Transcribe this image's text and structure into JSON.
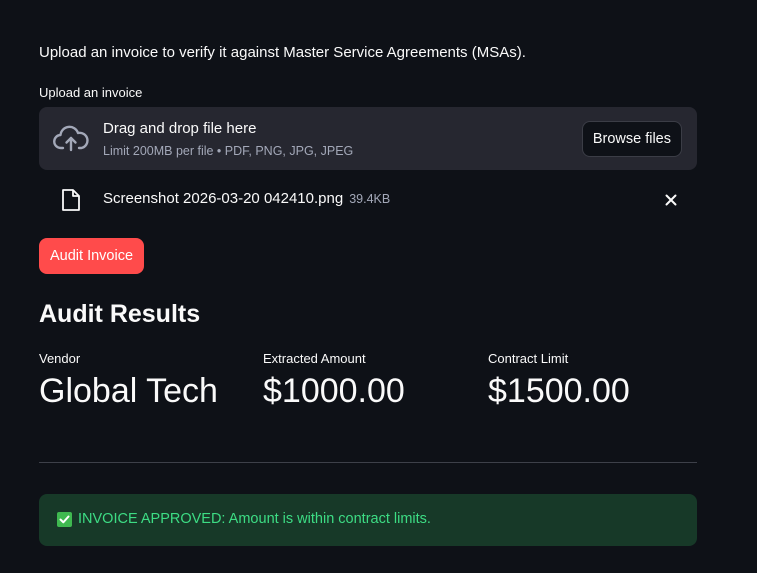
{
  "intro_text": "Upload an invoice to verify it against Master Service Agreements (MSAs).",
  "uploader": {
    "label": "Upload an invoice",
    "drop_title": "Drag and drop file here",
    "limit_text": "Limit 200MB per file • PDF, PNG, JPG, JPEG",
    "browse_label": "Browse files",
    "icon": "cloud-upload-icon"
  },
  "uploaded_file": {
    "name": "Screenshot 2026-03-20 042410.png",
    "size": "39.4KB",
    "icon": "file-icon",
    "remove_icon": "close-icon"
  },
  "audit_button_label": "Audit Invoice",
  "results": {
    "title": "Audit Results",
    "metrics": [
      {
        "label": "Vendor",
        "value": "Global Tech"
      },
      {
        "label": "Extracted Amount",
        "value": "$1000.00"
      },
      {
        "label": "Contract Limit",
        "value": "$1500.00"
      }
    ]
  },
  "status": {
    "icon": "check-box-icon",
    "text": "INVOICE APPROVED: Amount is within contract limits."
  },
  "colors": {
    "background": "#0e1117",
    "primary_button": "#ff4b4b",
    "success_background": "#173928",
    "success_text": "#3ddc84"
  }
}
